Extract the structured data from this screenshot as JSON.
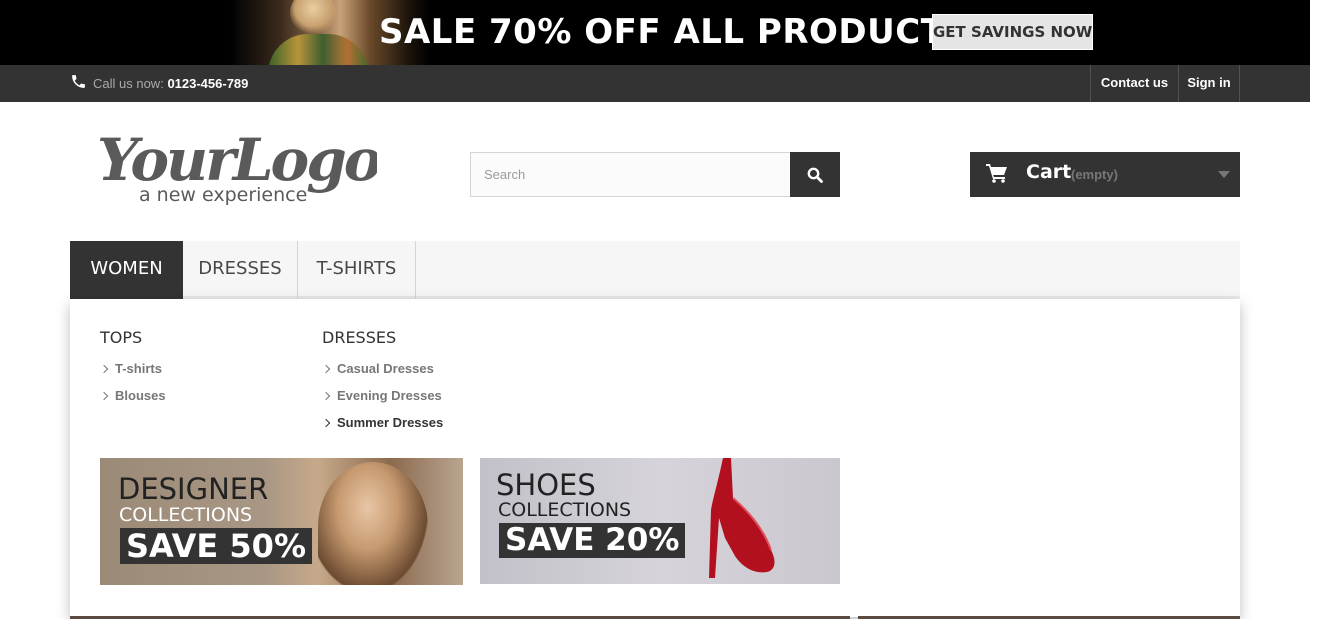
{
  "promo_banner": {
    "headline": "SALE 70% OFF ALL PRODUCTS",
    "cta_label": "GET SAVINGS NOW"
  },
  "top_bar": {
    "call_label": "Call us now:",
    "phone": "0123-456-789",
    "links": [
      {
        "label": "Contact us"
      },
      {
        "label": "Sign in"
      }
    ]
  },
  "header": {
    "logo_text": "YourLogo",
    "logo_tagline": "a new experience",
    "search_placeholder": "Search",
    "cart_label": "Cart",
    "cart_status": "(empty)"
  },
  "menu": {
    "items": [
      {
        "label": "WOMEN",
        "active": true
      },
      {
        "label": "DRESSES",
        "active": false
      },
      {
        "label": "T-SHIRTS",
        "active": false
      }
    ]
  },
  "dropdown": {
    "columns": [
      {
        "title": "TOPS",
        "links": [
          {
            "label": "T-shirts"
          },
          {
            "label": "Blouses"
          }
        ]
      },
      {
        "title": "DRESSES",
        "links": [
          {
            "label": "Casual Dresses"
          },
          {
            "label": "Evening Dresses"
          },
          {
            "label": "Summer Dresses",
            "hover": true
          }
        ]
      }
    ],
    "promos": [
      {
        "line1": "DESIGNER",
        "line2": "COLLECTIONS",
        "save": "SAVE 50%"
      },
      {
        "line1": "SHOES",
        "line2": "COLLECTIONS",
        "save": "SAVE 20%"
      }
    ]
  },
  "colors": {
    "dark": "#333333",
    "topbar": "#333333",
    "menu_bg": "#f6f6f6",
    "link_grey": "#777777"
  }
}
